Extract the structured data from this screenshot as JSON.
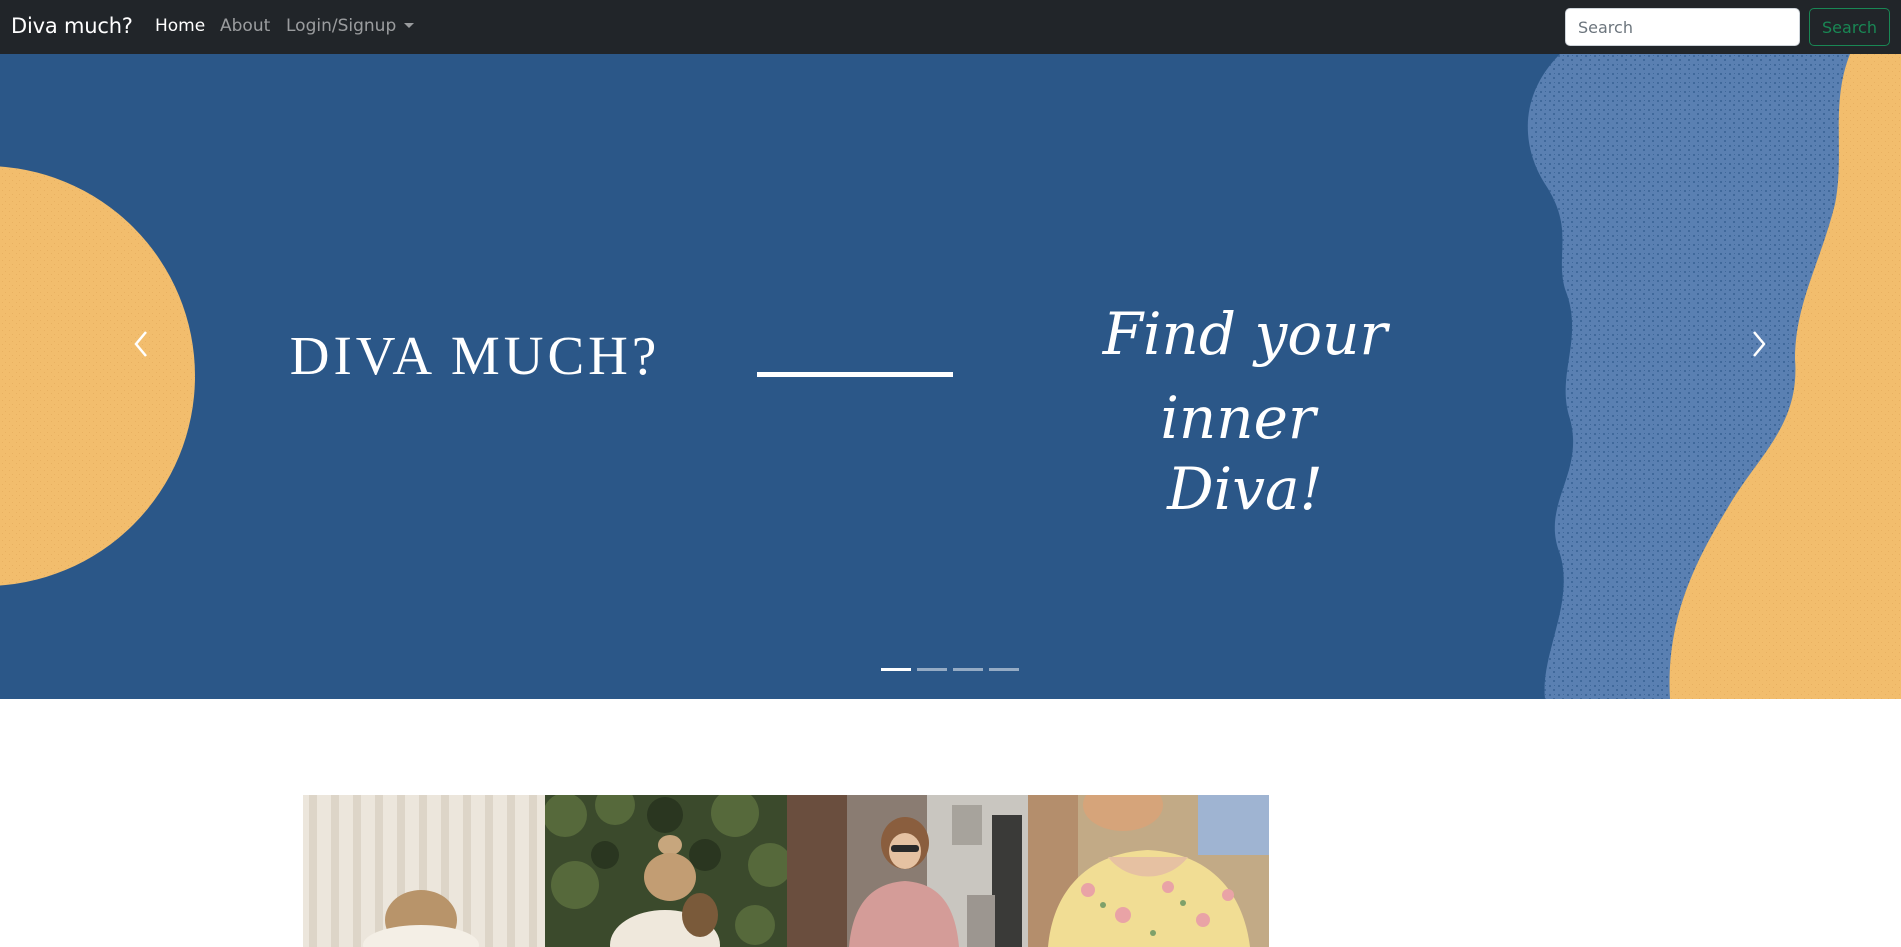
{
  "navbar": {
    "brand": "Diva much?",
    "links": [
      {
        "label": "Home",
        "active": true
      },
      {
        "label": "About",
        "active": false
      },
      {
        "label": "Login/Signup",
        "active": false,
        "dropdown": true
      }
    ],
    "search": {
      "placeholder": "Search",
      "value": "",
      "button_label": "Search"
    }
  },
  "carousel": {
    "slide_title": "DIVA MUCH?",
    "slide_tagline": [
      "Find your",
      "inner",
      "Diva!"
    ],
    "slide_count": 4,
    "active_slide": 1,
    "colors": {
      "background": "#2b5788",
      "accent": "#f2bd6d",
      "texture": "#5a80b2"
    },
    "prev_icon": "chevron-left-icon",
    "next_icon": "chevron-right-icon"
  },
  "gallery": {
    "images": [
      {
        "name": "fashion-photo-cream-sweater"
      },
      {
        "name": "fashion-photo-greenery"
      },
      {
        "name": "fashion-photo-pink-sweater"
      },
      {
        "name": "fashion-photo-floral-dress"
      }
    ]
  },
  "theme": {
    "navbar_bg": "#212529",
    "search_accent": "#198754"
  }
}
